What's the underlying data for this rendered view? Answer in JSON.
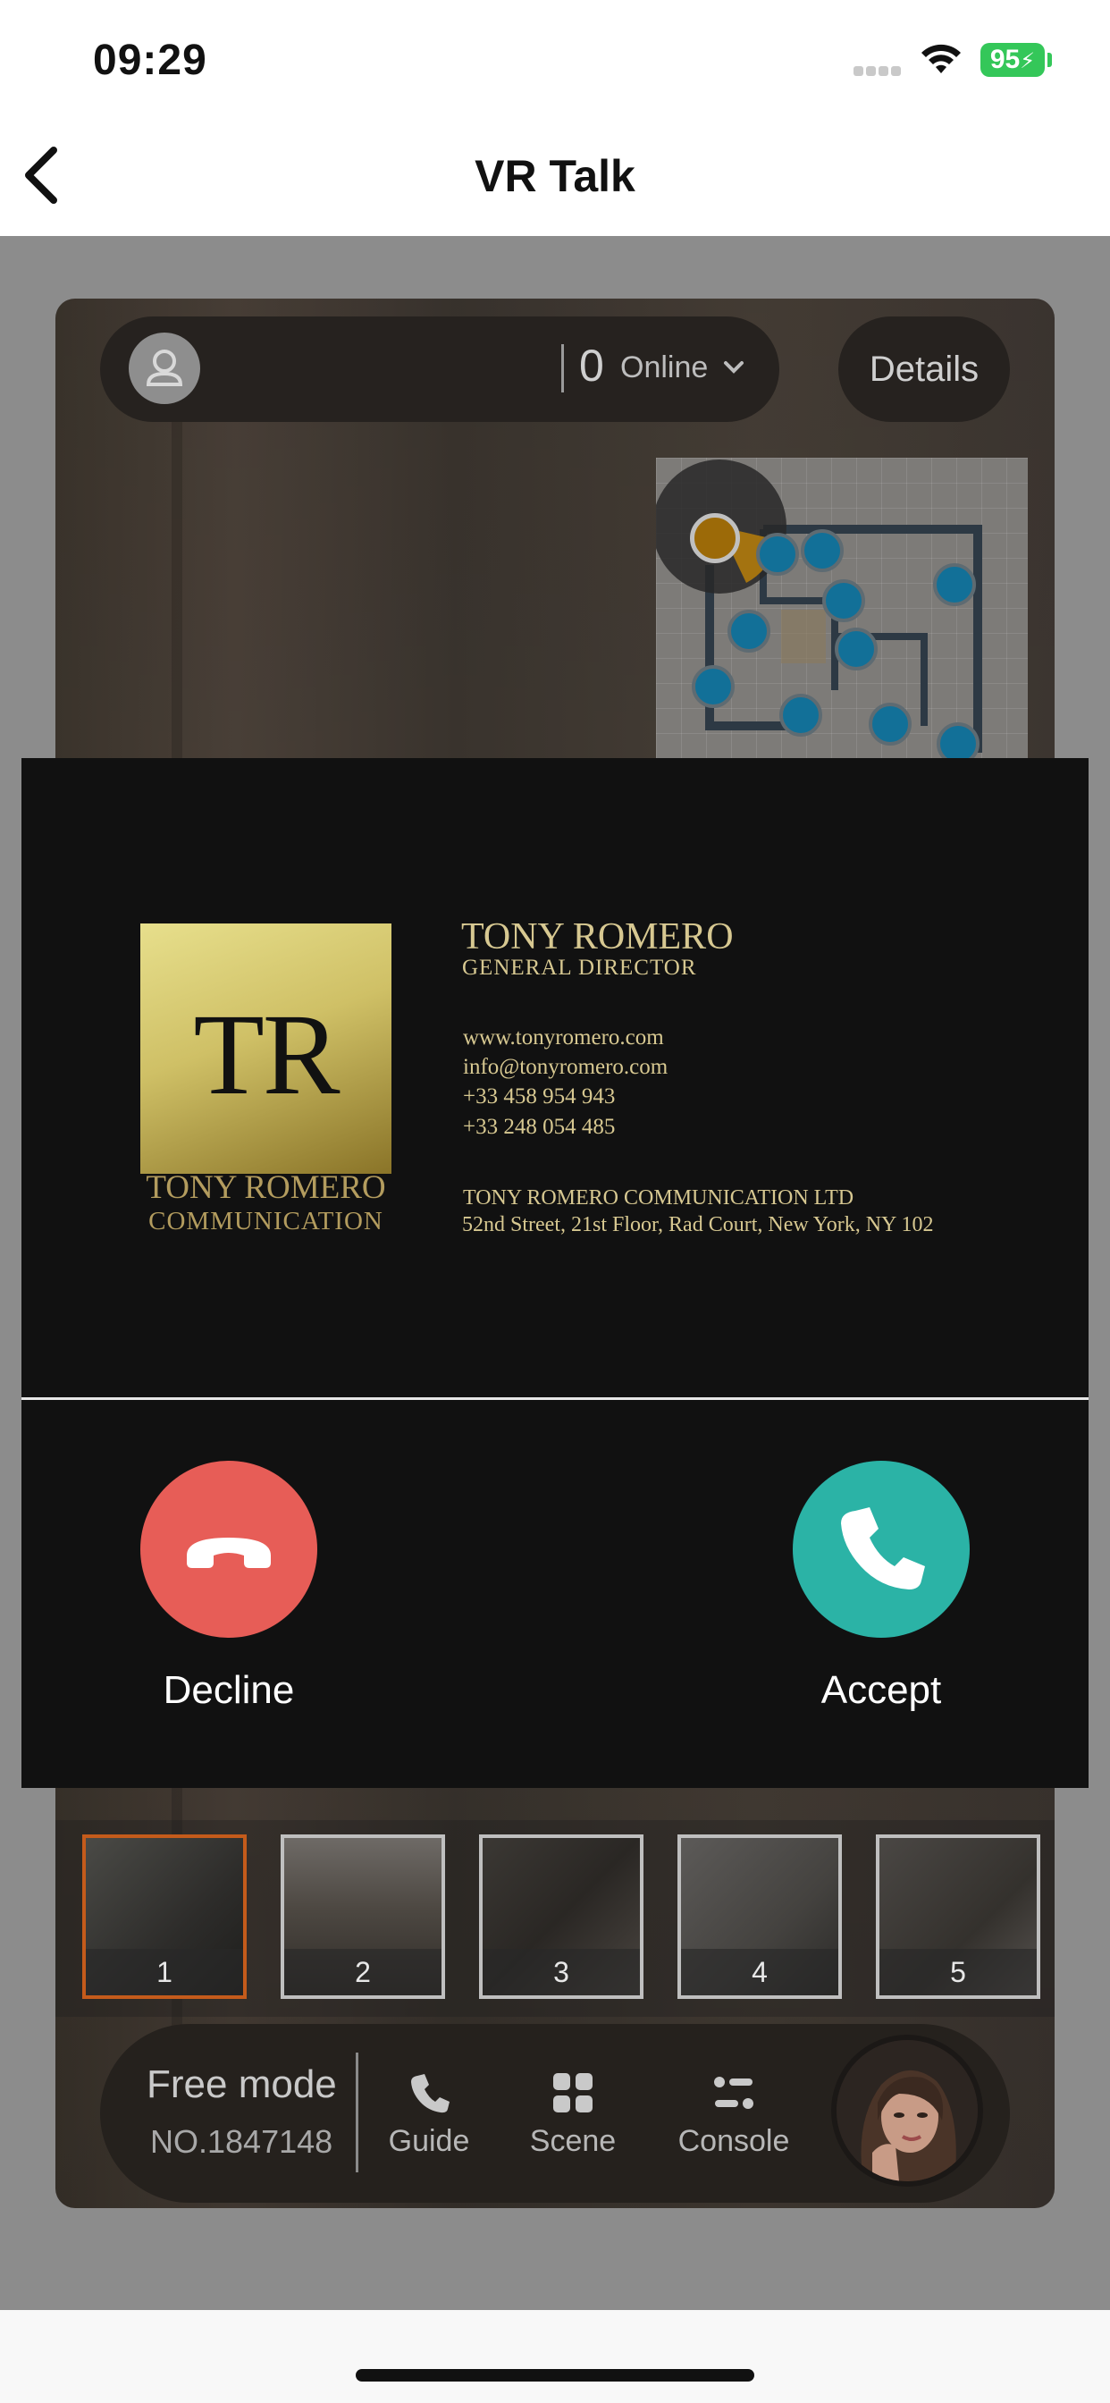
{
  "status_bar": {
    "time": "09:29",
    "battery": "95"
  },
  "nav": {
    "title": "VR Talk",
    "back_icon": "chevron-left-icon"
  },
  "vr_header": {
    "online_count": "0",
    "online_label": "Online",
    "details_label": "Details"
  },
  "call_card": {
    "logo_initials": "TR",
    "logo_name": "TONY ROMERO",
    "logo_sub": "COMMUNICATION",
    "name": "TONY ROMERO",
    "role": "GENERAL DIRECTOR",
    "website": "www.tonyromero.com",
    "email": "info@tonyromero.com",
    "phone1": "+33 458 954 943",
    "phone2": "+33 248 054 485",
    "company": "TONY ROMERO COMMUNICATION LTD",
    "address": "52nd Street, 21st Floor, Rad Court, New York, NY 102",
    "decline_label": "Decline",
    "accept_label": "Accept",
    "colors": {
      "decline": "#e75d57",
      "accept": "#2bb3a6",
      "gold": "#d7c891"
    }
  },
  "thumbnails": [
    {
      "label": "1",
      "active": true
    },
    {
      "label": "2",
      "active": false
    },
    {
      "label": "3",
      "active": false
    },
    {
      "label": "4",
      "active": false
    },
    {
      "label": "5",
      "active": false
    }
  ],
  "bottom_bar": {
    "mode_label": "Free mode",
    "mode_number": "NO.1847148",
    "tools": [
      {
        "label": "Guide",
        "icon": "phone-icon"
      },
      {
        "label": "Scene",
        "icon": "grid-icon"
      },
      {
        "label": "Console",
        "icon": "console-icon"
      }
    ]
  }
}
